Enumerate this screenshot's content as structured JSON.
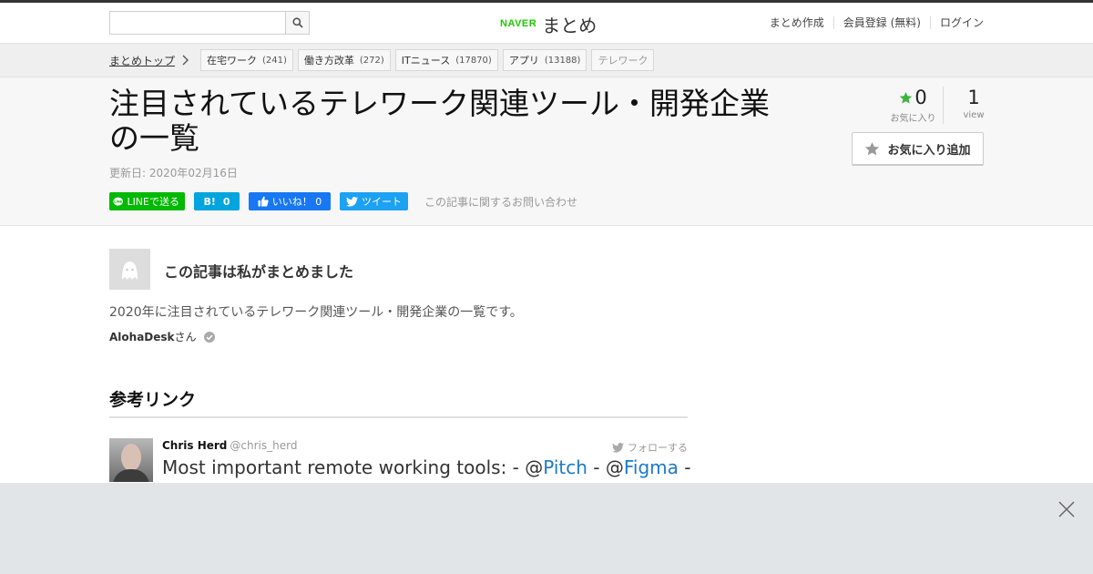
{
  "header": {
    "logo_brand": "NAVER",
    "logo_title": "まとめ",
    "nav": [
      "まとめ作成",
      "会員登録 (無料)",
      "ログイン"
    ]
  },
  "search": {
    "value": "",
    "placeholder": ""
  },
  "breadcrumb": {
    "top": "まとめトップ",
    "tags": [
      {
        "label": "在宅ワーク",
        "count": "(241)"
      },
      {
        "label": "働き方改革",
        "count": "(272)"
      },
      {
        "label": "ITニュース",
        "count": "(17870)"
      },
      {
        "label": "アプリ",
        "count": "(13188)"
      },
      {
        "label": "テレワーク",
        "count": ""
      }
    ]
  },
  "article": {
    "title": "注目されているテレワーク関連ツール・開発企業の一覧",
    "updated": "更新日: 2020年02月16日",
    "share": {
      "line": "LINEで送る",
      "hatena_count": "0",
      "fb_label": "いいね！ 0",
      "tweet": "ツイート"
    },
    "inquiry": "この記事に関するお問い合わせ",
    "favorites": {
      "count": "0",
      "label": "お気に入り"
    },
    "views": {
      "count": "1",
      "label": "view"
    },
    "add_favorite": "お気に入り追加"
  },
  "author": {
    "heading": "この記事は私がまとめました",
    "description": "2020年に注目されているテレワーク関連ツール・開発企業の一覧です。",
    "name": "AlohaDesk",
    "suffix": "さん"
  },
  "section": {
    "title": "参考リンク"
  },
  "tweet": {
    "name": "Chris Herd",
    "handle": "@chris_herd",
    "follow": "フォローする",
    "text_prefix": "Most important remote working tools: - @",
    "link1": "Pitch",
    "text_mid": " - @",
    "link2": "Figma",
    "text_suffix": " -"
  },
  "colors": {
    "brand_green": "#1ec800",
    "line_green": "#00b900",
    "hatena_blue": "#00a4de",
    "facebook_blue": "#1877f2",
    "twitter_blue": "#1da1f2",
    "link_blue": "#1b7ac9",
    "star_green": "#3db33d"
  },
  "icons": {
    "search": "search-icon",
    "breadcrumb": "chevron-right-icon",
    "favorite": "star-icon",
    "verified": "verified-icon",
    "close": "close-icon"
  }
}
